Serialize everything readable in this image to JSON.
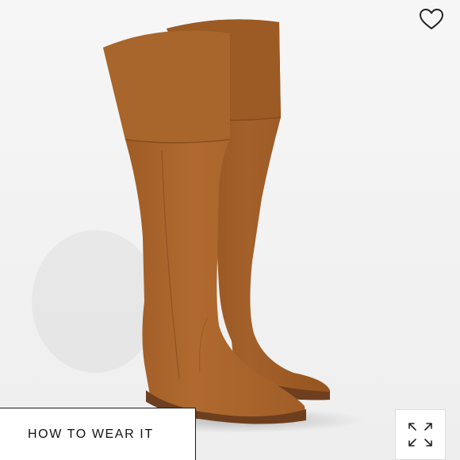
{
  "product_image": {
    "alt_icon": "over-the-knee-boots-image"
  },
  "favorite": {
    "icon": "heart-outline-icon",
    "color": "#222222"
  },
  "how_to_wear": {
    "label": "HOW TO WEAR IT"
  },
  "expand": {
    "icon": "expand-arrows-icon"
  },
  "colors": {
    "background": "#f4f4f4",
    "suede": "#a7622a",
    "suede_dark": "#8a4d1e",
    "sole": "#6e3f1f"
  }
}
